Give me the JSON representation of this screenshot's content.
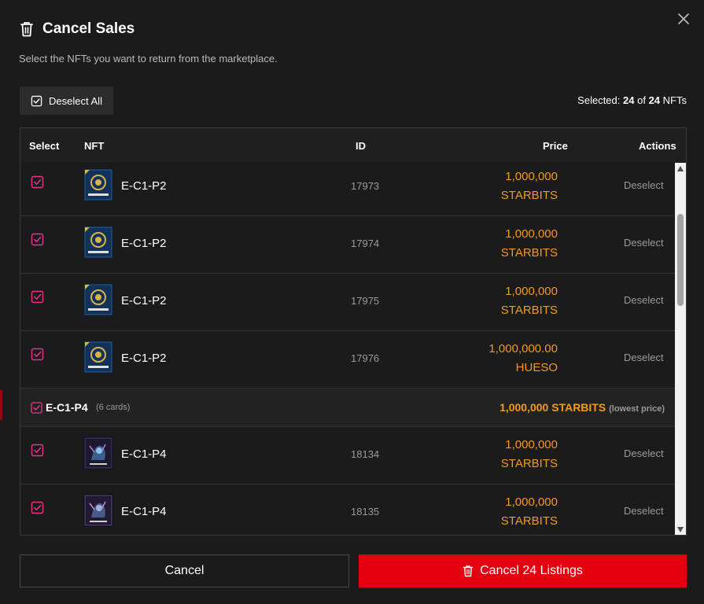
{
  "modal": {
    "title": "Cancel Sales",
    "subtitle": "Select the NFTs you want to return from the marketplace."
  },
  "toolbar": {
    "deselect_all_label": "Deselect All",
    "selected_prefix": "Selected:",
    "selected_count": "24",
    "of_label": "of",
    "total_count": "24",
    "unit_label": "NFTs"
  },
  "table": {
    "headers": {
      "select": "Select",
      "nft": "NFT",
      "id": "ID",
      "price": "Price",
      "actions": "Actions"
    },
    "rows": [
      {
        "name": "E-C1-P2",
        "id": "17973",
        "price_amount": "1,000,000",
        "price_currency": "STARBITS",
        "action": "Deselect"
      },
      {
        "name": "E-C1-P2",
        "id": "17974",
        "price_amount": "1,000,000",
        "price_currency": "STARBITS",
        "action": "Deselect"
      },
      {
        "name": "E-C1-P2",
        "id": "17975",
        "price_amount": "1,000,000",
        "price_currency": "STARBITS",
        "action": "Deselect"
      },
      {
        "name": "E-C1-P2",
        "id": "17976",
        "price_amount": "1,000,000.00",
        "price_currency": "HUESO",
        "action": "Deselect"
      }
    ],
    "group": {
      "name": "E-C1-P4",
      "count": "(6 cards)",
      "price": "1,000,000 STARBITS",
      "price_note": "(lowest price)"
    },
    "group_rows": [
      {
        "name": "E-C1-P4",
        "id": "18134",
        "price_amount": "1,000,000",
        "price_currency": "STARBITS",
        "action": "Deselect"
      },
      {
        "name": "E-C1-P4",
        "id": "18135",
        "price_amount": "1,000,000",
        "price_currency": "STARBITS",
        "action": "Deselect"
      }
    ]
  },
  "footer": {
    "cancel_label": "Cancel",
    "confirm_label": "Cancel 24 Listings"
  },
  "colors": {
    "accent": "#e3000f",
    "price": "#f29b1b",
    "checkbox": "#e8348f",
    "background": "#1b1b1b"
  }
}
